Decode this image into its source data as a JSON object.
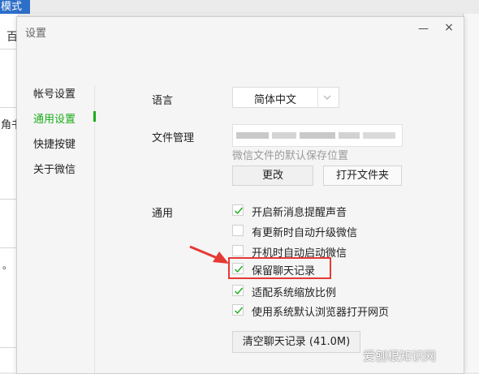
{
  "background": {
    "tab_label": "模式",
    "glyphs": [
      "百",
      "角书",
      "。"
    ]
  },
  "dialog": {
    "title": "设置",
    "minimize_glyph": "—",
    "close_glyph": "×"
  },
  "nav": {
    "items": [
      {
        "label": "帐号设置"
      },
      {
        "label": "通用设置",
        "active": true
      },
      {
        "label": "快捷按键"
      },
      {
        "label": "关于微信"
      }
    ]
  },
  "language": {
    "label": "语言",
    "value": "简体中文"
  },
  "file_management": {
    "label": "文件管理",
    "hint": "微信文件的默认保存位置",
    "change_button": "更改",
    "open_folder_button": "打开文件夹"
  },
  "general": {
    "label": "通用",
    "options": [
      {
        "label": "开启新消息提醒声音",
        "checked": true
      },
      {
        "label": "有更新时自动升级微信",
        "checked": false
      },
      {
        "label": "开机时自动启动微信",
        "checked": false
      },
      {
        "label": "保留聊天记录",
        "checked": true,
        "highlighted": true
      },
      {
        "label": "适配系统缩放比例",
        "checked": true
      },
      {
        "label": "使用系统默认浏览器打开网页",
        "checked": true
      }
    ],
    "clear_button": "清空聊天记录 (41.0M)"
  },
  "colors": {
    "accent_green": "#1aad19",
    "highlight_red": "#e53935",
    "tab_blue": "#2d6ec8"
  },
  "watermark": "爱刨根知识网"
}
